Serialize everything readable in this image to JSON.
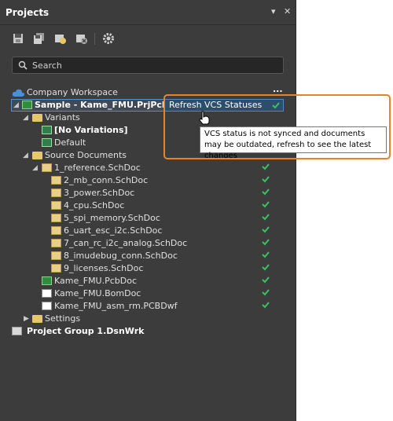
{
  "panel": {
    "title": "Projects",
    "menu_glyph": "▾",
    "close_glyph": "✕"
  },
  "toolbar": {
    "icons": [
      "save-icon",
      "save-all-icon",
      "open-project-icon",
      "close-project-icon",
      "settings-icon"
    ]
  },
  "search": {
    "placeholder": "Search"
  },
  "tree": {
    "workspace": "Company Workspace",
    "workspace_menu": "...",
    "project": "Sample - Kame_FMU.PrjPcb",
    "variants": "Variants",
    "no_variations": "[No Variations]",
    "default": "Default",
    "source_documents": "Source Documents",
    "ref_doc": "1_reference.SchDoc",
    "sheets": [
      "2_mb_conn.SchDoc",
      "3_power.SchDoc",
      "4_cpu.SchDoc",
      "5_spi_memory.SchDoc",
      "6_uart_esc_i2c.SchDoc",
      "7_can_rc_i2c_analog.SchDoc",
      "8_imudebug_conn.SchDoc",
      "9_licenses.SchDoc"
    ],
    "pcb": "Kame_FMU.PcbDoc",
    "bom": "Kame_FMU.BomDoc",
    "pcbdwf": "Kame_FMU_asm_rm.PCBDwf",
    "settings": "Settings",
    "project_group": "Project Group 1.DsnWrk"
  },
  "refresh": {
    "label": "Refresh VCS Statuses"
  },
  "tooltip": {
    "text": "VCS status is not synced and documents may be outdated, refresh to see the latest changes"
  },
  "colors": {
    "accent_orange": "#e8832a",
    "check_green": "#3fbf5f",
    "panel_bg": "#3c3c3c",
    "selection_blue": "#4f86c4"
  }
}
